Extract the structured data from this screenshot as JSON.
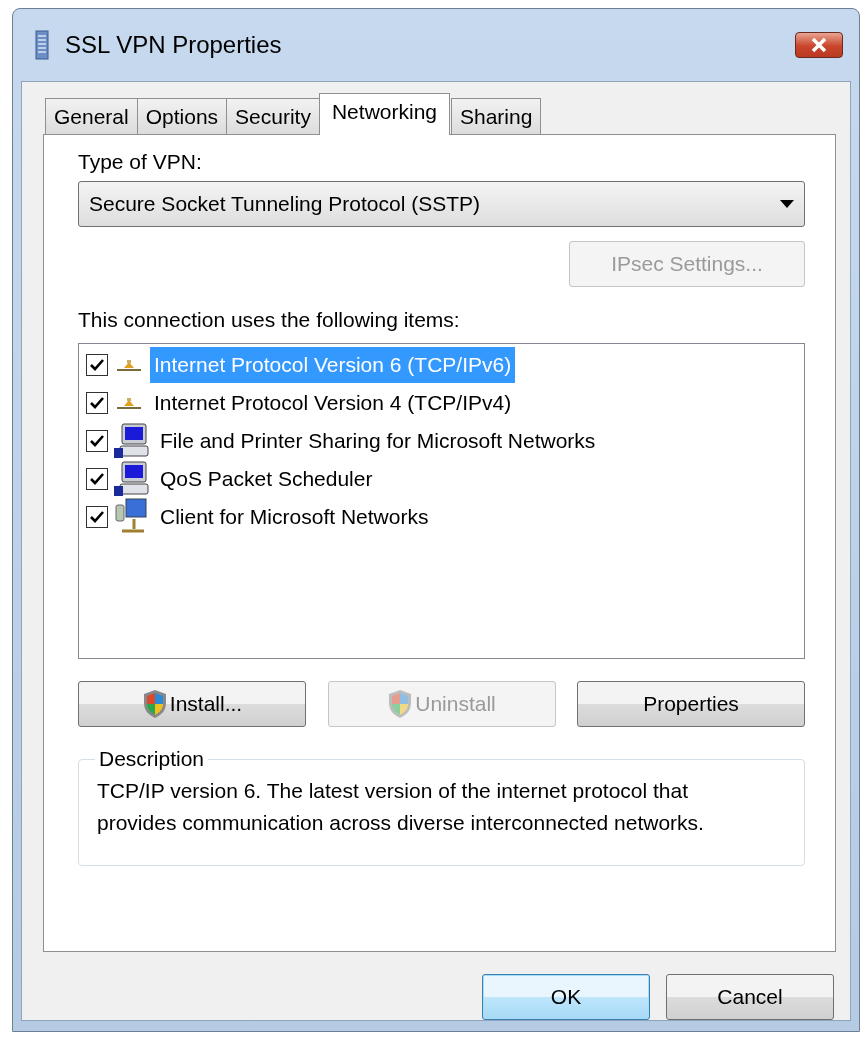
{
  "window": {
    "title": "SSL VPN Properties"
  },
  "tabs": [
    {
      "label": "General",
      "selected": false
    },
    {
      "label": "Options",
      "selected": false
    },
    {
      "label": "Security",
      "selected": false
    },
    {
      "label": "Networking",
      "selected": true
    },
    {
      "label": "Sharing",
      "selected": false
    }
  ],
  "vpn_type": {
    "label": "Type of VPN:",
    "value": "Secure Socket Tunneling Protocol (SSTP)"
  },
  "ipsec_button": {
    "label": "IPsec Settings...",
    "disabled": true
  },
  "items_label": "This connection uses the following items:",
  "items": [
    {
      "kind": "protocol",
      "label": "Internet Protocol Version 6 (TCP/IPv6)",
      "checked": true,
      "selected": true
    },
    {
      "kind": "protocol",
      "label": "Internet Protocol Version 4 (TCP/IPv4)",
      "checked": true,
      "selected": false
    },
    {
      "kind": "service",
      "label": "File and Printer Sharing for Microsoft Networks",
      "checked": true,
      "selected": false
    },
    {
      "kind": "service",
      "label": "QoS Packet Scheduler",
      "checked": true,
      "selected": false
    },
    {
      "kind": "client",
      "label": "Client for Microsoft Networks",
      "checked": true,
      "selected": false
    }
  ],
  "item_buttons": [
    {
      "label": "Install...",
      "shield": true,
      "disabled": false
    },
    {
      "label": "Uninstall",
      "shield": true,
      "disabled": true
    },
    {
      "label": "Properties",
      "shield": false,
      "disabled": false
    }
  ],
  "description": {
    "title": "Description",
    "text": "TCP/IP version 6. The latest version of the internet protocol that provides communication across diverse interconnected networks."
  },
  "footer_buttons": [
    {
      "label": "OK",
      "default": true
    },
    {
      "label": "Cancel",
      "default": false
    }
  ]
}
